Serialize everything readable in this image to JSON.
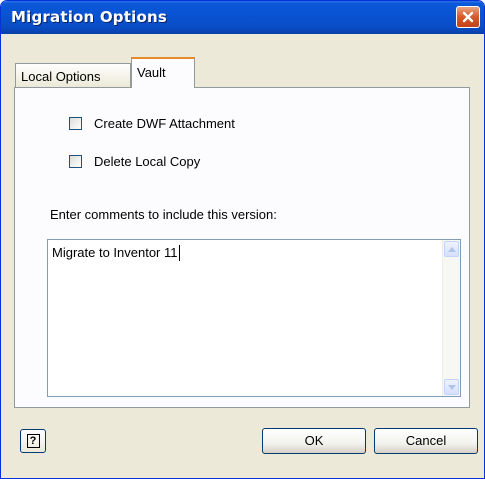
{
  "window": {
    "title": "Migration Options"
  },
  "tabs": [
    {
      "label": "Local Options",
      "active": false
    },
    {
      "label": "Vault",
      "active": true
    }
  ],
  "vault": {
    "create_dwf": {
      "label": "Create DWF Attachment",
      "checked": false
    },
    "delete_local": {
      "label": "Delete Local Copy",
      "checked": false
    },
    "comments_label": "Enter comments to include this version:",
    "comments_value": "Migrate to Inventor 11"
  },
  "footer": {
    "help_glyph": "?",
    "ok_label": "OK",
    "cancel_label": "Cancel"
  },
  "colors": {
    "titlebar": "#0853d2",
    "close_button": "#d6582a",
    "dialog_face": "#ece9d8",
    "active_tab_highlight": "#e68b2c"
  },
  "icons": [
    "close-icon",
    "scroll-up-arrow-icon",
    "scroll-down-arrow-icon",
    "help-icon"
  ]
}
